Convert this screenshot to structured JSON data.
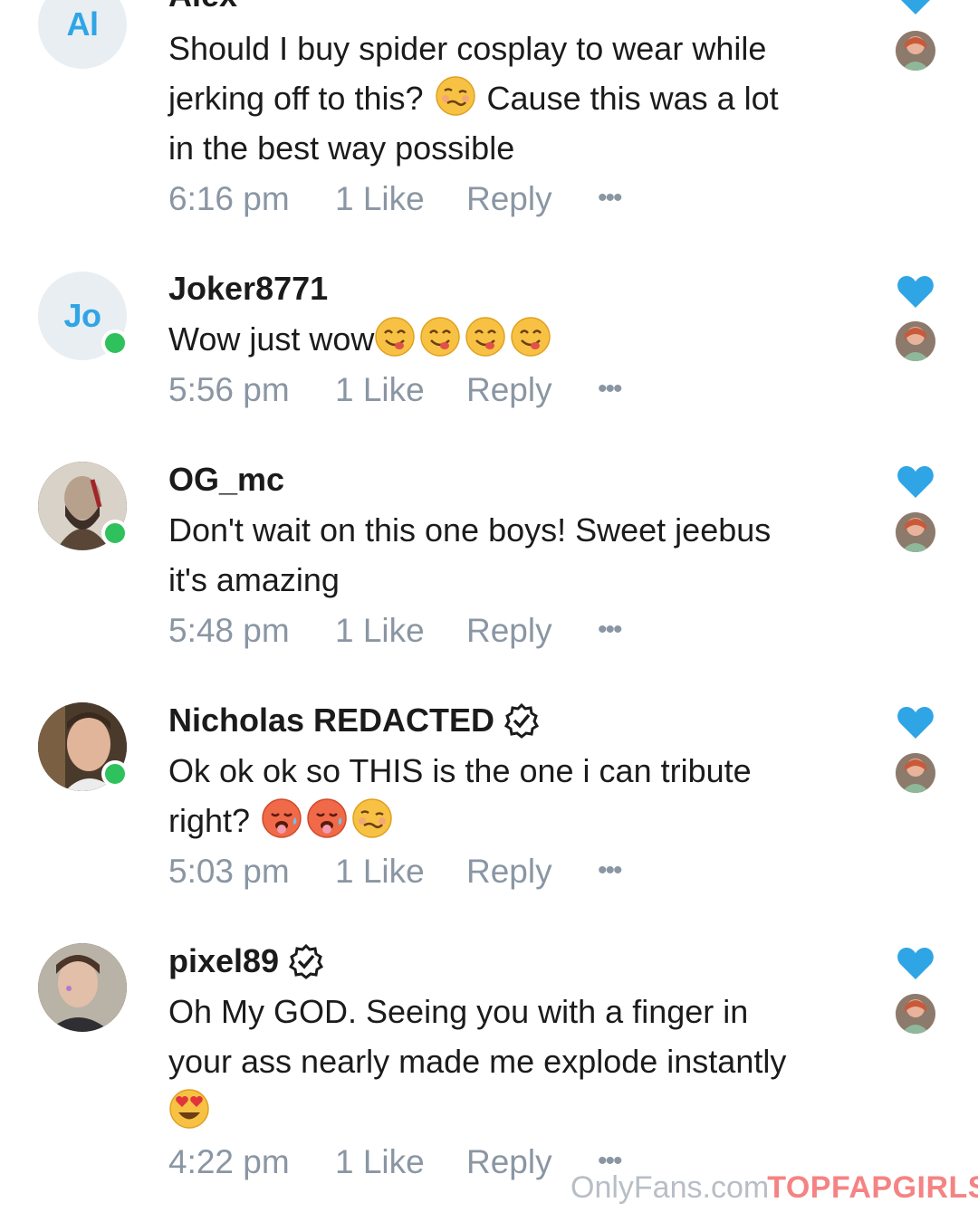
{
  "comments": [
    {
      "initials": "Al",
      "name": "Alex",
      "text_parts": [
        "Should I buy spider cosplay to wear while jerking off to this? ",
        "woozy-face-emoji",
        " Cause this was a lot in the best way possible"
      ],
      "line1": "Should I buy spider cosplay to wear while",
      "line2a": "jerking off to this?",
      "line2b": "Cause this was a lot",
      "line3": "in the best way possible",
      "time": "6:16 pm",
      "likes": "1 Like",
      "reply": "Reply",
      "more": "•••"
    },
    {
      "initials": "Jo",
      "name": "Joker8771",
      "line1": "Wow just wow",
      "time": "5:56 pm",
      "likes": "1 Like",
      "reply": "Reply",
      "more": "•••"
    },
    {
      "name": "OG_mc",
      "line1": "Don't wait on this one boys! Sweet jeebus",
      "line2": "it's amazing",
      "time": "5:48 pm",
      "likes": "1 Like",
      "reply": "Reply",
      "more": "•••"
    },
    {
      "name": "Nicholas REDACTED",
      "line1": "Ok ok ok so THIS is the one i can tribute",
      "line2": "right?",
      "time": "5:03 pm",
      "likes": "1 Like",
      "reply": "Reply",
      "more": "•••"
    },
    {
      "name": "pixel89",
      "line1": "Oh My GOD. Seeing you with a finger in",
      "line2": "your ass nearly made me explode instantly",
      "time": "4:22 pm",
      "likes": "1 Like",
      "reply": "Reply",
      "more": "•••"
    }
  ],
  "watermark": {
    "site": "OnlyFans.com",
    "brand": "TOPFAPGIRLS"
  },
  "colors": {
    "accent": "#2fa5e6",
    "heart": "#2fa5e6",
    "meta": "#8a96a3",
    "online": "#2ec15c"
  },
  "icons": [
    "heart-icon",
    "verified-icon",
    "more-icon",
    "woozy-face-emoji",
    "yum-face-emoji",
    "hot-face-emoji",
    "heart-eyes-emoji"
  ]
}
